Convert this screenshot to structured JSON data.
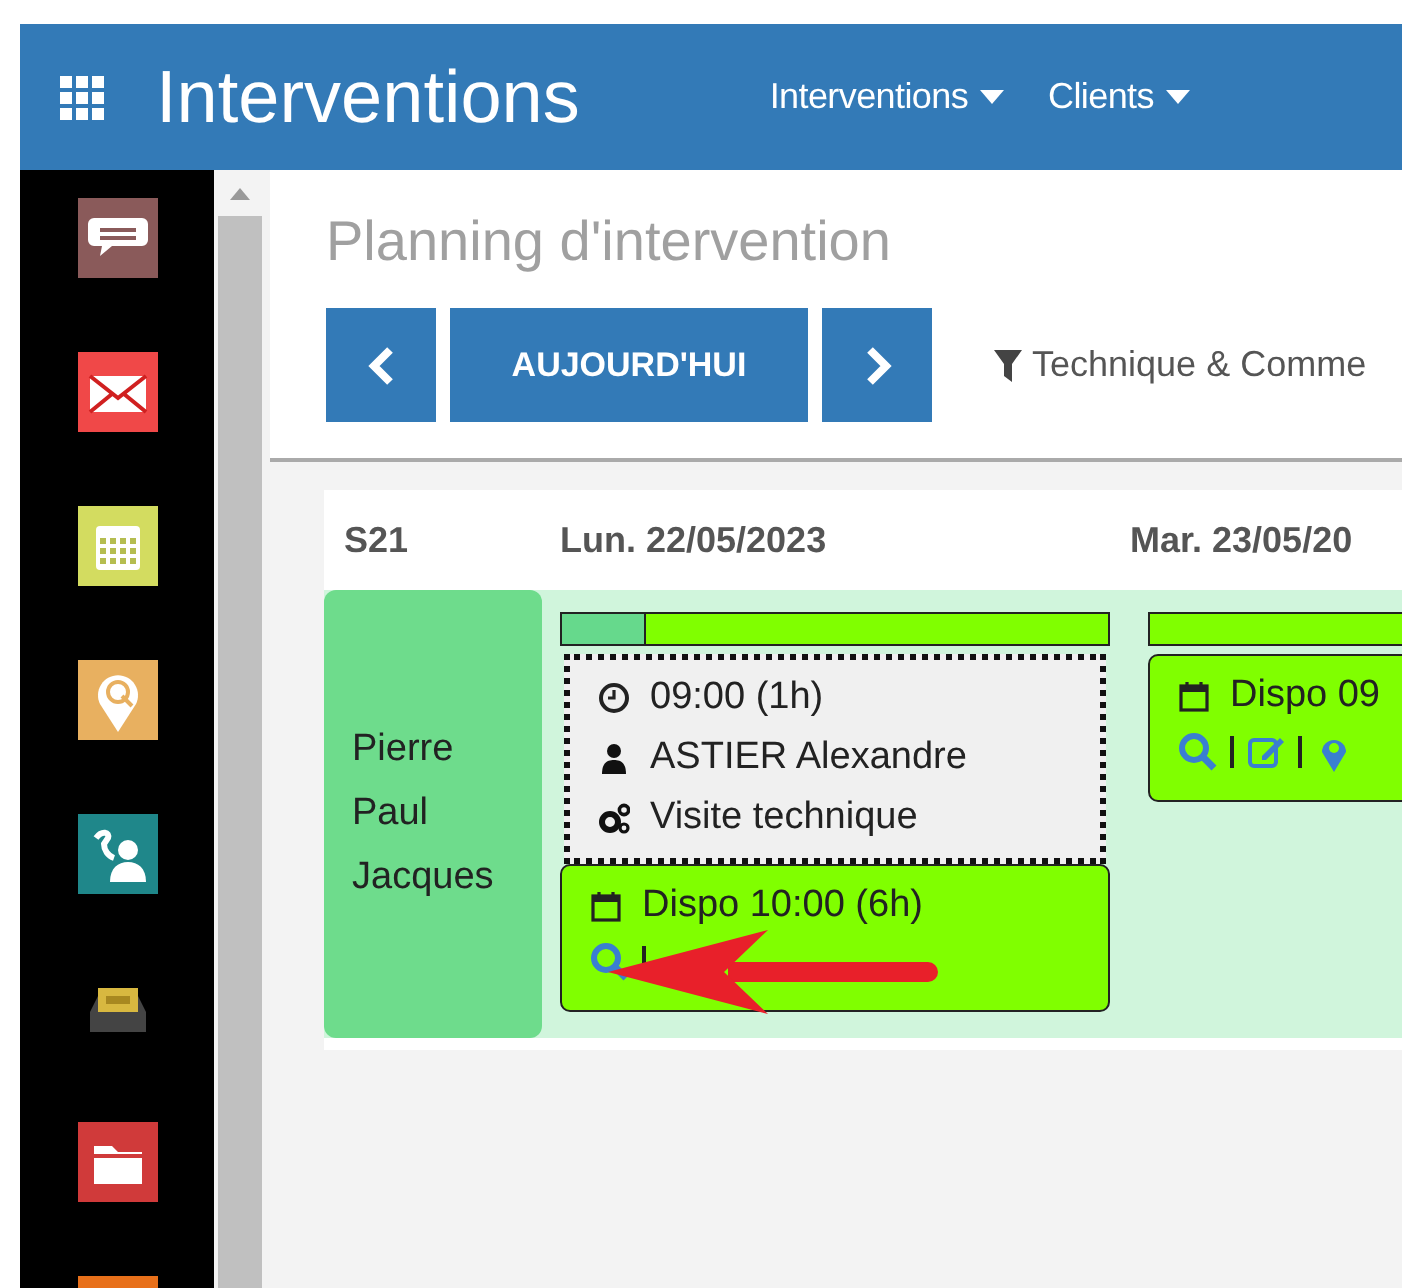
{
  "header": {
    "title": "Interventions",
    "menus": [
      {
        "label": "Interventions"
      },
      {
        "label": "Clients"
      }
    ]
  },
  "sidebar": {
    "items": [
      {
        "kind": "chat"
      },
      {
        "kind": "mail"
      },
      {
        "kind": "calendar"
      },
      {
        "kind": "pin"
      },
      {
        "kind": "contact"
      },
      {
        "kind": "box"
      },
      {
        "kind": "folder"
      },
      {
        "kind": "partial"
      }
    ]
  },
  "page": {
    "title": "Planning d'intervention",
    "nav_buttons": [
      {
        "kind": "prev"
      },
      {
        "kind": "today",
        "label": "AUJOURD'HUI"
      },
      {
        "kind": "next"
      }
    ],
    "filter": "Technique & Comme"
  },
  "planning": {
    "week": "S21",
    "technicians": [
      "Pierre",
      "Paul",
      "Jacques"
    ],
    "days": [
      {
        "label": "Lun. 22/05/2023",
        "level": 0.15,
        "events": [
          {
            "kind": "intervention",
            "time": "09:00 (1h)",
            "client": "ASTIER Alexandre",
            "type": "Visite technique"
          },
          {
            "kind": "dispo",
            "label": "Dispo 10:00 (6h)",
            "actions": [
              {
                "kind": "search"
              },
              {
                "kind": "separator"
              }
            ]
          }
        ]
      },
      {
        "label": "Mar. 23/05/20",
        "events": [
          {
            "kind": "dispo",
            "label": "Dispo 09",
            "actions": [
              {
                "kind": "search"
              },
              {
                "kind": "separator"
              },
              {
                "kind": "edit"
              },
              {
                "kind": "separator"
              },
              {
                "kind": "pin"
              }
            ]
          }
        ]
      }
    ]
  }
}
